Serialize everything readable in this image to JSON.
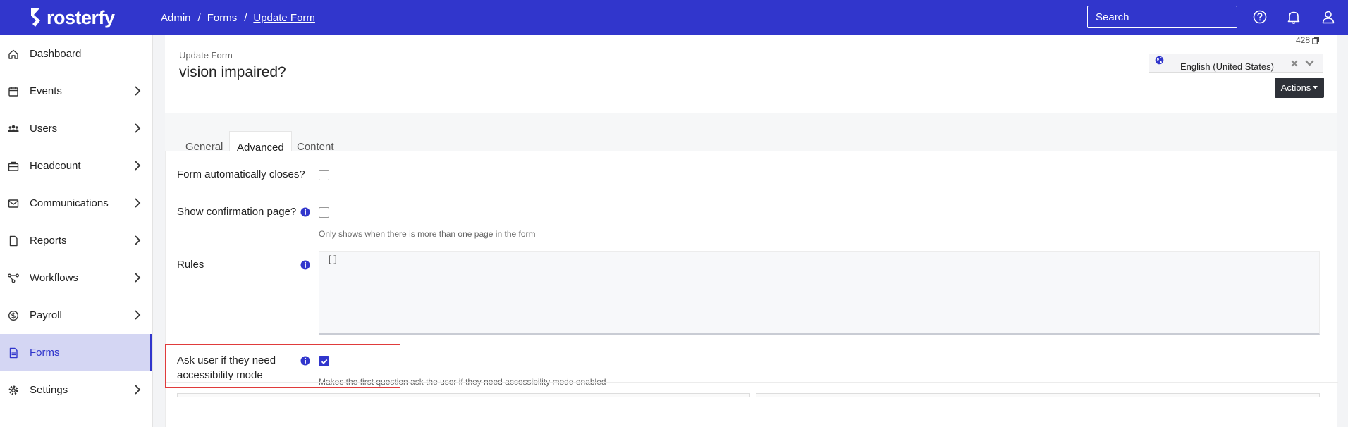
{
  "app": {
    "logo_text": "rosterfy"
  },
  "breadcrumb": [
    {
      "label": "Admin"
    },
    {
      "label": "Forms"
    },
    {
      "label": "Update Form"
    }
  ],
  "breadcrumb_separator": "/",
  "search": {
    "placeholder": "Search"
  },
  "sidebar": {
    "items": [
      {
        "label": "Dashboard",
        "icon": "home-icon"
      },
      {
        "label": "Events",
        "icon": "calendar-icon"
      },
      {
        "label": "Users",
        "icon": "users-icon"
      },
      {
        "label": "Headcount",
        "icon": "briefcase-icon"
      },
      {
        "label": "Communications",
        "icon": "mail-icon"
      },
      {
        "label": "Reports",
        "icon": "file-icon"
      },
      {
        "label": "Workflows",
        "icon": "workflow-icon"
      },
      {
        "label": "Payroll",
        "icon": "dollar-icon"
      },
      {
        "label": "Forms",
        "icon": "form-icon",
        "active": true
      },
      {
        "label": "Settings",
        "icon": "gear-icon"
      }
    ]
  },
  "header": {
    "record_id": "428",
    "subtitle": "Update Form",
    "title": "vision impaired?",
    "language": "English (United States)",
    "actions_label": "Actions"
  },
  "tabs": [
    {
      "label": "General"
    },
    {
      "label": "Advanced",
      "active": true
    },
    {
      "label": "Content"
    }
  ],
  "form": {
    "auto_close": {
      "label": "Form automatically closes?",
      "checked": false
    },
    "confirmation": {
      "label": "Show confirmation page?",
      "checked": false,
      "help": "Only shows when there is more than one page in the form"
    },
    "rules": {
      "label": "Rules",
      "value": "[]"
    },
    "accessibility": {
      "label": "Ask user if they need accessibility mode",
      "checked": true,
      "help": "Makes the first question ask the user if they need accessibility mode enabled"
    }
  },
  "colors": {
    "brand": "#3136cc",
    "highlight": "#e03b3b",
    "dark_button": "#2e3138"
  }
}
